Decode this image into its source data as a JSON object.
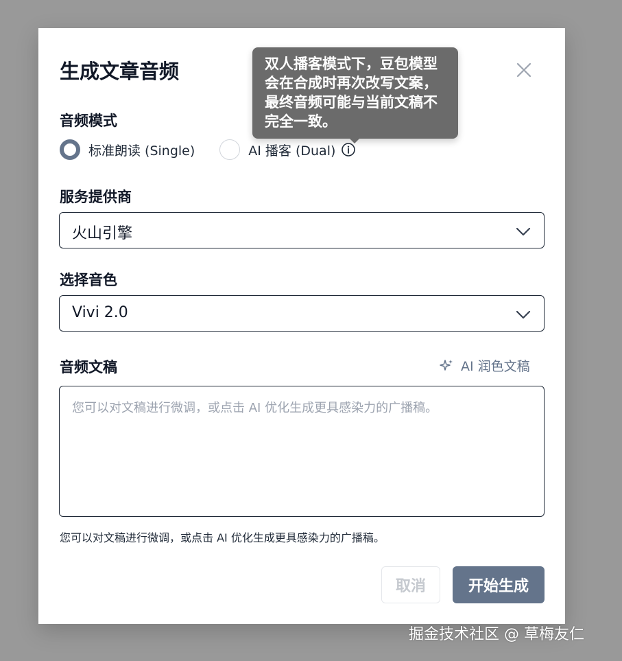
{
  "dialog": {
    "title": "生成文章音频",
    "close_icon": "close-icon"
  },
  "audio_mode": {
    "label": "音频模式",
    "options": [
      {
        "label": "标准朗读 (Single)",
        "checked": true
      },
      {
        "label": "AI 播客 (Dual)",
        "checked": false,
        "icon": "info-icon"
      }
    ],
    "tooltip": "双人播客模式下，豆包模型会在合成时再次改写文案，最终音频可能与当前文稿不完全一致。"
  },
  "provider": {
    "label": "服务提供商",
    "value": "火山引擎",
    "icon": "chevron-down-icon"
  },
  "voice": {
    "label": "选择音色",
    "value": "Vivi 2.0",
    "icon": "chevron-down-icon"
  },
  "script": {
    "label": "音频文稿",
    "polish_button": "AI 润色文稿",
    "polish_icon": "sparkle-icon",
    "placeholder": "您可以对文稿进行微调，或点击 AI 优化生成更具感染力的广播稿。",
    "value": "",
    "helper": "您可以对文稿进行微调，或点击 AI 优化生成更具感染力的广播稿。"
  },
  "actions": {
    "cancel": "取消",
    "start": "开始生成"
  },
  "watermark": "掘金技术社区 @ 草梅友仁",
  "colors": {
    "overlay": "#999999",
    "accent": "#64748b",
    "tooltip_bg": "#6b6b6b",
    "border": "#1f2937"
  }
}
